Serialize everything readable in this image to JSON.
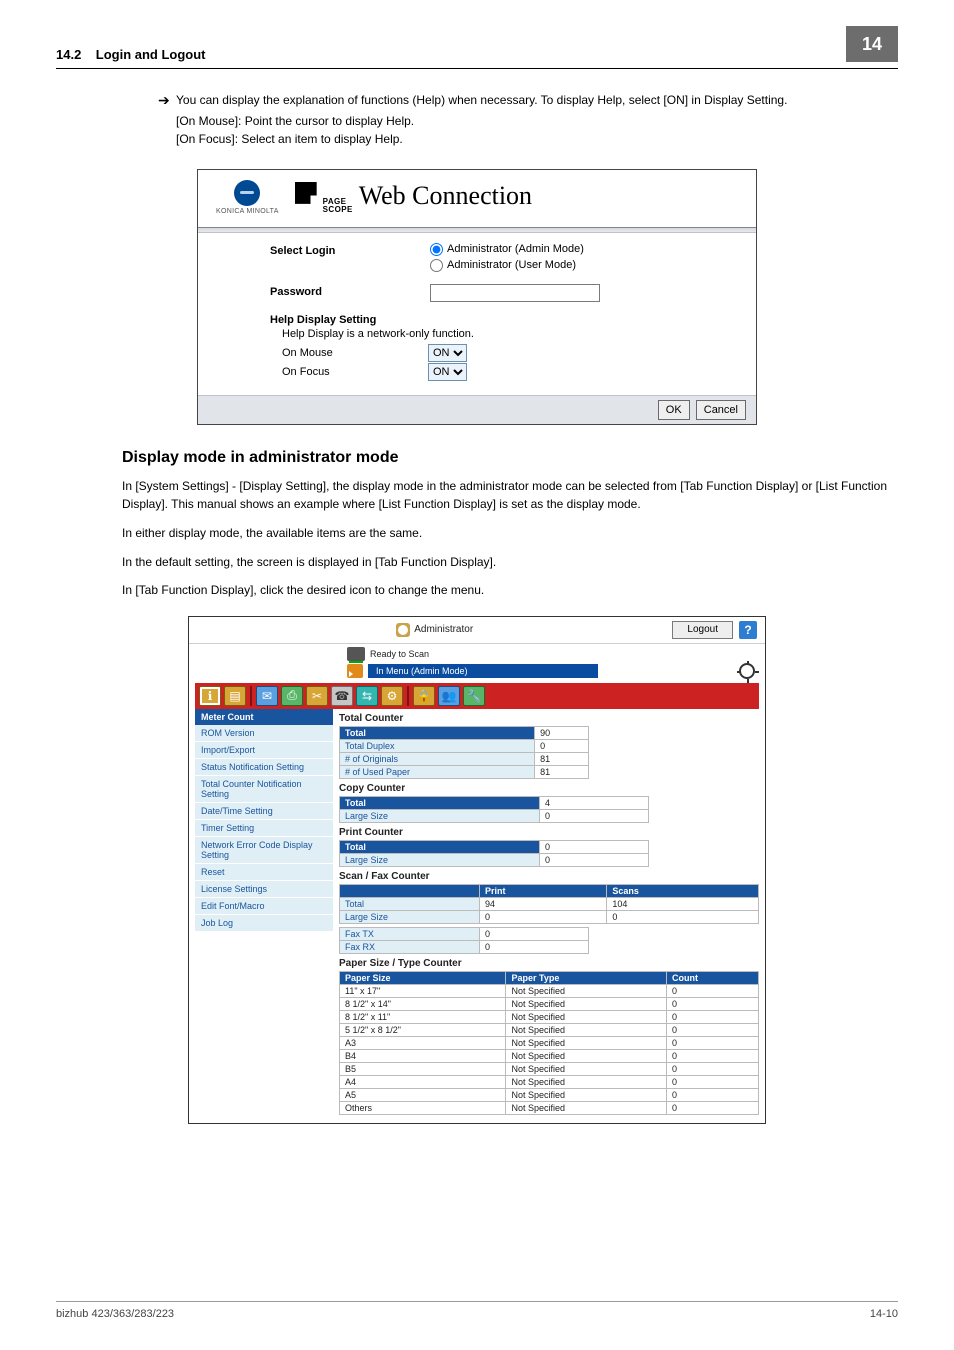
{
  "header": {
    "section": "14.2",
    "title": "Login and Logout",
    "chapter": "14"
  },
  "intro": {
    "bullet": "You can display the explanation of functions (Help) when necessary. To display Help, select [ON] in Display Setting.",
    "mouse": "[On Mouse]: Point the cursor to display Help.",
    "focus": "[On Focus]: Select an item to display Help."
  },
  "login": {
    "brand_small": "KONICA MINOLTA",
    "ps_line1": "PAGE",
    "ps_line2": "SCOPE",
    "ps_big": "Web Connection",
    "select_login": "Select Login",
    "radio_admin": "Administrator (Admin Mode)",
    "radio_user": "Administrator (User Mode)",
    "password": "Password",
    "help_title": "Help Display Setting",
    "help_sub": "Help Display is a network-only function.",
    "on_mouse": "On Mouse",
    "on_focus": "On Focus",
    "on_opt": "ON",
    "ok": "OK",
    "cancel": "Cancel"
  },
  "section": {
    "heading": "Display mode in administrator mode",
    "p1": "In [System Settings] - [Display Setting], the display mode in the administrator mode can be selected from [Tab Function Display] or [List Function Display]. This manual shows an example where [List Function Display] is set as the display mode.",
    "p2": "In either display mode, the available items are the same.",
    "p3": "In the default setting, the screen is displayed in [Tab Function Display].",
    "p4": "In [Tab Function Display], click the desired icon to change the menu."
  },
  "shot2": {
    "admin": "Administrator",
    "logout": "Logout",
    "ready": "Ready to Scan",
    "crumb": "In Menu (Admin Mode)",
    "nav_header": "Meter Count",
    "nav": [
      "ROM Version",
      "Import/Export",
      "Status Notification Setting",
      "Total Counter Notification Setting",
      "Date/Time Setting",
      "Timer Setting",
      "Network Error Code Display Setting",
      "Reset",
      "License Settings",
      "Edit Font/Macro",
      "Job Log"
    ],
    "total_counter": {
      "title": "Total Counter",
      "rows": [
        [
          "Total",
          "90"
        ],
        [
          "Total Duplex",
          "0"
        ],
        [
          "# of Originals",
          "81"
        ],
        [
          "# of Used Paper",
          "81"
        ]
      ]
    },
    "copy_counter": {
      "title": "Copy Counter",
      "rows": [
        [
          "Total",
          "4"
        ],
        [
          "Large Size",
          "0"
        ]
      ]
    },
    "print_counter": {
      "title": "Print Counter",
      "rows": [
        [
          "Total",
          "0"
        ],
        [
          "Large Size",
          "0"
        ]
      ]
    },
    "scan_fax": {
      "title": "Scan / Fax Counter",
      "head": [
        "",
        "Print",
        "Scans"
      ],
      "rows": [
        [
          "Total",
          "94",
          "104"
        ],
        [
          "Large Size",
          "0",
          "0"
        ]
      ]
    },
    "fax_tr": {
      "rows": [
        [
          "Fax TX",
          "0"
        ],
        [
          "Fax RX",
          "0"
        ]
      ]
    },
    "paper": {
      "title": "Paper Size / Type Counter",
      "head": [
        "Paper Size",
        "Paper Type",
        "Count"
      ],
      "rows": [
        [
          "11\" x 17\"",
          "Not Specified",
          "0"
        ],
        [
          "8 1/2\" x 14\"",
          "Not Specified",
          "0"
        ],
        [
          "8 1/2\" x 11\"",
          "Not Specified",
          "0"
        ],
        [
          "5 1/2\" x 8 1/2\"",
          "Not Specified",
          "0"
        ],
        [
          "A3",
          "Not Specified",
          "0"
        ],
        [
          "B4",
          "Not Specified",
          "0"
        ],
        [
          "B5",
          "Not Specified",
          "0"
        ],
        [
          "A4",
          "Not Specified",
          "0"
        ],
        [
          "A5",
          "Not Specified",
          "0"
        ],
        [
          "Others",
          "Not Specified",
          "0"
        ]
      ]
    }
  },
  "footer": {
    "left": "bizhub 423/363/283/223",
    "right": "14-10"
  }
}
